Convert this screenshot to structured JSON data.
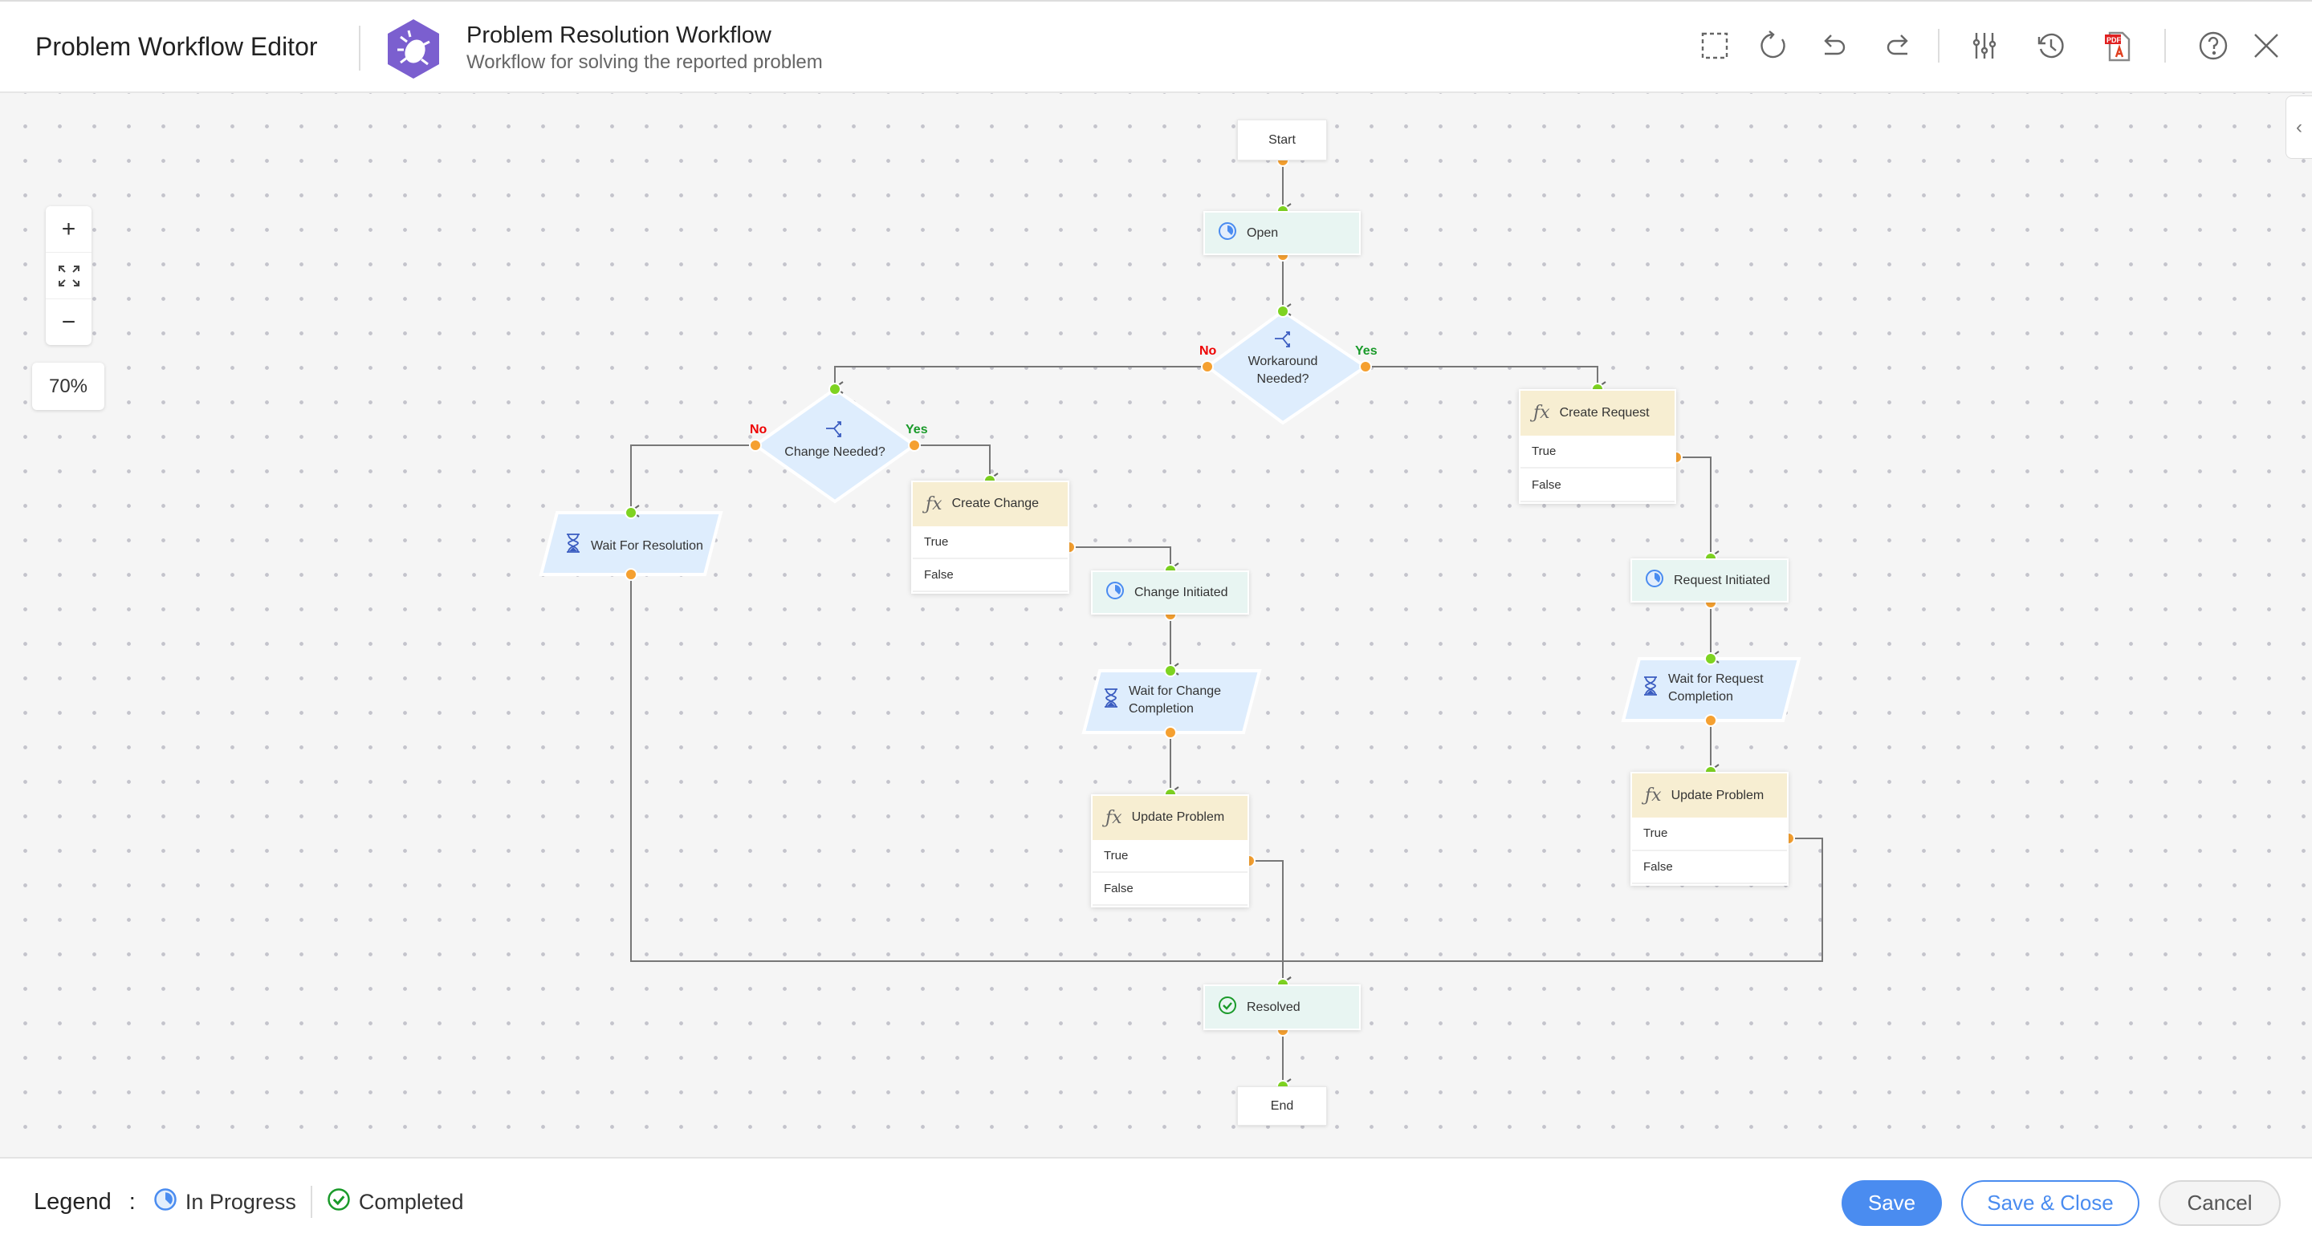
{
  "header": {
    "app_title": "Problem Workflow Editor",
    "workflow_title": "Problem Resolution Workflow",
    "workflow_subtitle": "Workflow for solving the reported problem",
    "logo_icon": "bug-hexagon-icon",
    "logo_color": "#7b5fcf",
    "toolbar": [
      "select-area-icon",
      "refresh-icon",
      "undo-icon",
      "redo-icon",
      "settings-sliders-icon",
      "history-icon",
      "pdf-export-icon",
      "help-icon",
      "close-icon"
    ]
  },
  "canvas": {
    "zoom_level": "70%",
    "zoom_in": "+",
    "zoom_out": "−",
    "nodes": {
      "start": "Start",
      "open": "Open",
      "workaround": "Workaround Needed?",
      "change_needed": "Change Needed?",
      "create_request": {
        "title": "Create Request",
        "true": "True",
        "false": "False"
      },
      "create_change": {
        "title": "Create Change",
        "true": "True",
        "false": "False"
      },
      "wait_resolution": "Wait For Resolution",
      "change_initiated": "Change Initiated",
      "wait_change": "Wait for Change Completion",
      "update_problem_1": {
        "title": "Update Problem",
        "true": "True",
        "false": "False"
      },
      "request_initiated": "Request Initiated",
      "wait_request": "Wait for Request Completion",
      "update_problem_2": {
        "title": "Update Problem",
        "true": "True",
        "false": "False"
      },
      "resolved": "Resolved",
      "end": "End"
    },
    "branch_labels": {
      "no": "No",
      "yes": "Yes"
    },
    "colors": {
      "input_port": "#7ed321",
      "output_port": "#f5a030",
      "status_node": "#e8f5f2",
      "decision_node": "#deedfd",
      "function_header": "#f7eed2",
      "no": "#ee0000",
      "yes": "#1a9a2a"
    }
  },
  "footer": {
    "legend_label": "Legend",
    "legend_colon": ":",
    "legend_items": [
      {
        "label": "In Progress",
        "icon": "in-progress-icon"
      },
      {
        "label": "Completed",
        "icon": "completed-check-icon"
      }
    ],
    "buttons": {
      "save": "Save",
      "save_close": "Save & Close",
      "cancel": "Cancel"
    },
    "accent": "#4a8cf0"
  }
}
